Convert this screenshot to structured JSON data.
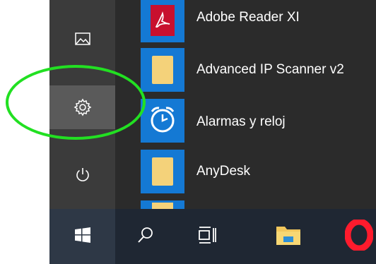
{
  "colors": {
    "rail_bg": "#3b3b3b",
    "applist_bg": "#2b2b2b",
    "tile_blue": "#1479d4",
    "folder_yellow": "#f4d27a",
    "adobe_red": "#c8102e",
    "taskbar_bg": "#1f2733",
    "annotation_green": "#22e022"
  },
  "rail": {
    "items": [
      {
        "id": "pictures",
        "icon": "picture-icon"
      },
      {
        "id": "settings",
        "icon": "gear-icon"
      },
      {
        "id": "power",
        "icon": "power-icon"
      }
    ]
  },
  "apps": [
    {
      "label": "Adobe Reader XI",
      "icon": "adobe-reader-icon"
    },
    {
      "label": "Advanced IP Scanner v2",
      "icon": "folder-icon"
    },
    {
      "label": "Alarmas y reloj",
      "icon": "alarm-clock-icon"
    },
    {
      "label": "AnyDesk",
      "icon": "folder-icon"
    }
  ],
  "taskbar": {
    "items": [
      {
        "id": "start",
        "icon": "windows-logo-icon"
      },
      {
        "id": "search",
        "icon": "search-icon"
      },
      {
        "id": "task-view",
        "icon": "task-view-icon"
      },
      {
        "id": "file-explorer",
        "icon": "file-explorer-icon"
      },
      {
        "id": "opera",
        "icon": "opera-icon"
      }
    ]
  }
}
